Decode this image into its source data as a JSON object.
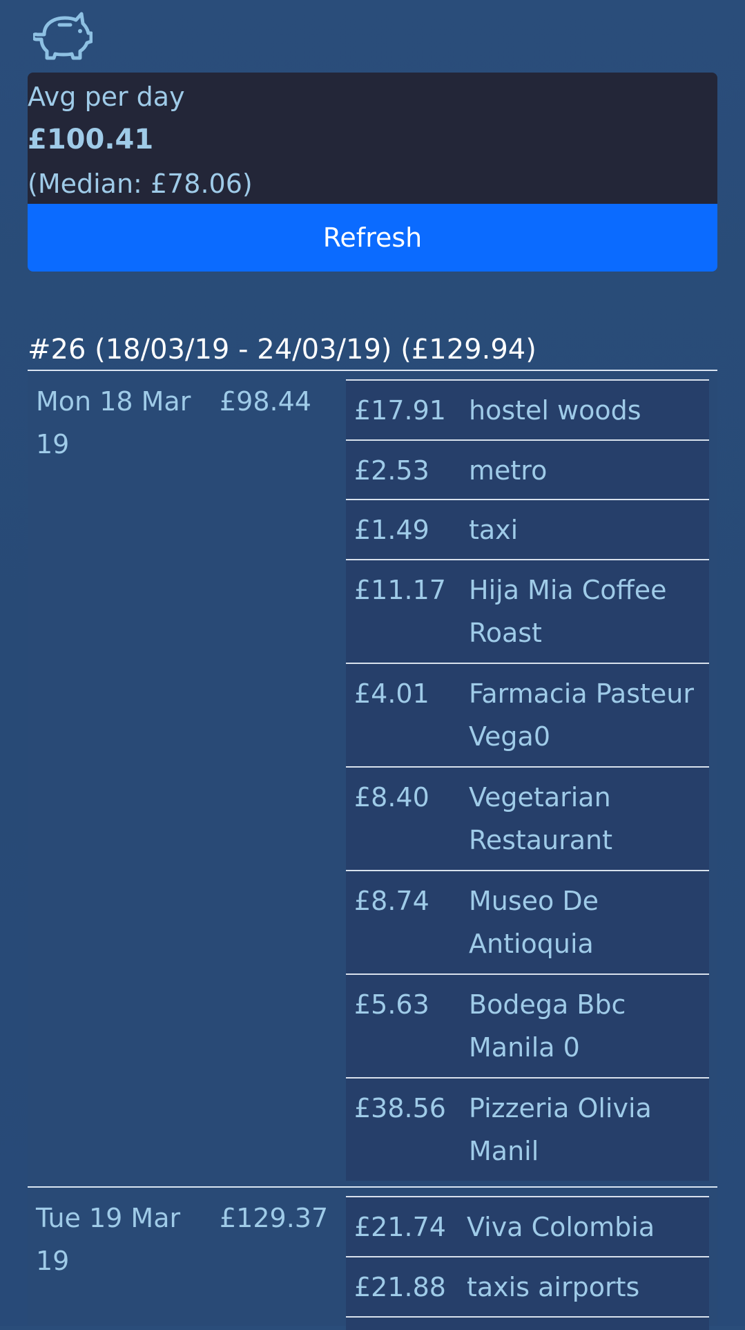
{
  "app": {
    "logo_icon": "piggy-bank-icon"
  },
  "stats": {
    "label": "Avg per day",
    "value": "£100.41",
    "median": "(Median: £78.06)"
  },
  "refresh": {
    "label": "Refresh"
  },
  "week": {
    "heading": "#26 (18/03/19 - 24/03/19) (£129.94)"
  },
  "days": [
    {
      "date": "Mon 18 Mar 19",
      "total": "£98.44",
      "transactions": [
        {
          "amount": "£17.91",
          "description": "hostel woods"
        },
        {
          "amount": "£2.53",
          "description": "metro"
        },
        {
          "amount": "£1.49",
          "description": "taxi"
        },
        {
          "amount": "£11.17",
          "description": "Hija Mia Coffee Roast"
        },
        {
          "amount": "£4.01",
          "description": "Farmacia Pasteur Vega0"
        },
        {
          "amount": "£8.40",
          "description": "Vegetarian Restaurant"
        },
        {
          "amount": "£8.74",
          "description": "Museo De Antioquia"
        },
        {
          "amount": "£5.63",
          "description": "Bodega Bbc Manila 0"
        },
        {
          "amount": "£38.56",
          "description": "Pizzeria Olivia Manil"
        }
      ]
    },
    {
      "date": "Tue 19 Mar 19",
      "total": "£129.37",
      "transactions": [
        {
          "amount": "£21.74",
          "description": "Viva Colombia"
        },
        {
          "amount": "£21.88",
          "description": "taxis airports"
        }
      ]
    }
  ],
  "colors": {
    "background": "#2a4d7a",
    "card": "#232638",
    "button": "#0b6bff",
    "text": "#9fcbe8"
  }
}
